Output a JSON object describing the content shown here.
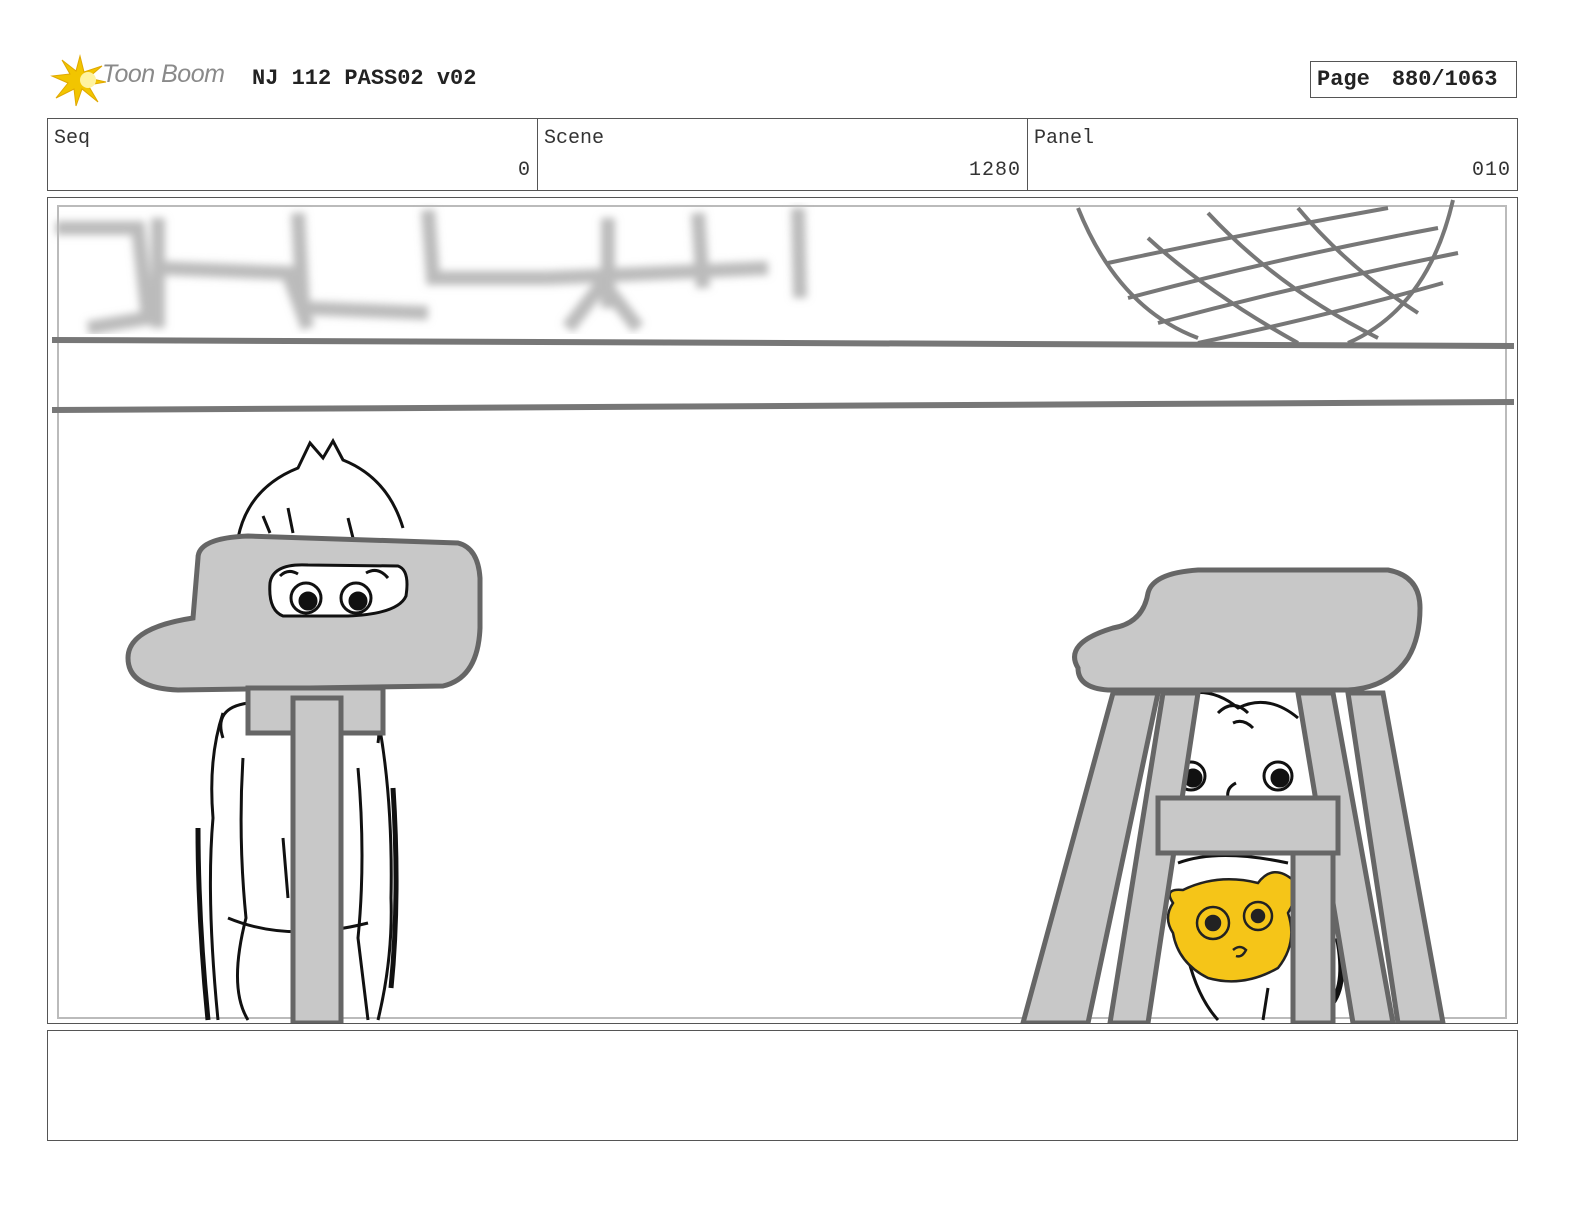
{
  "header": {
    "logo_text": "Toon Boom",
    "title": "NJ 112 PASS02 v02",
    "page_label": "Page",
    "page_value": "880/1063"
  },
  "info": {
    "seq_label": "Seq",
    "seq_value": "0",
    "scene_label": "Scene",
    "scene_value": "1280",
    "panel_label": "Panel",
    "panel_value": "010"
  },
  "notes": {
    "text": ""
  },
  "colors": {
    "logo_star": "#f2c500",
    "prop_gray": "#c8c8c8",
    "line_gray": "#777777",
    "creature_yellow": "#f5c518"
  }
}
